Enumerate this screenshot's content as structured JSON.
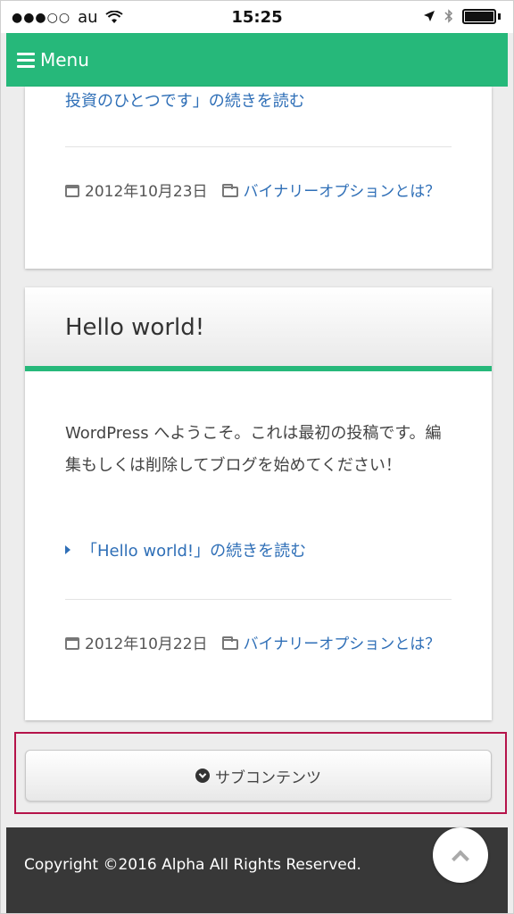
{
  "status_bar": {
    "signal": "●●●○○",
    "carrier": "au",
    "time": "15:25"
  },
  "navbar": {
    "menu_label": "Menu",
    "color": "#26b87a"
  },
  "posts": [
    {
      "read_more": "投資のひとつです」の続きを読む",
      "date": "2012年10月23日",
      "category": "バイナリーオプションとは？"
    },
    {
      "title": "Hello world!",
      "excerpt": "WordPress へようこそ。これは最初の投稿です。編集もしくは削除してブログを始めてください！",
      "read_more": "「Hello world!」の続きを読む",
      "date": "2012年10月22日",
      "category": "バイナリーオプションとは？"
    }
  ],
  "sub_contents": {
    "label": "サブコンテンツ"
  },
  "footer": {
    "copyright": "Copyright ©2016 Alpha All Rights Reserved."
  },
  "icons": {
    "menu": "hamburger-icon",
    "calendar": "calendar-icon",
    "folder": "folder-icon",
    "chevron": "chevron-circle-down-icon",
    "to_top": "chevron-up-icon"
  }
}
